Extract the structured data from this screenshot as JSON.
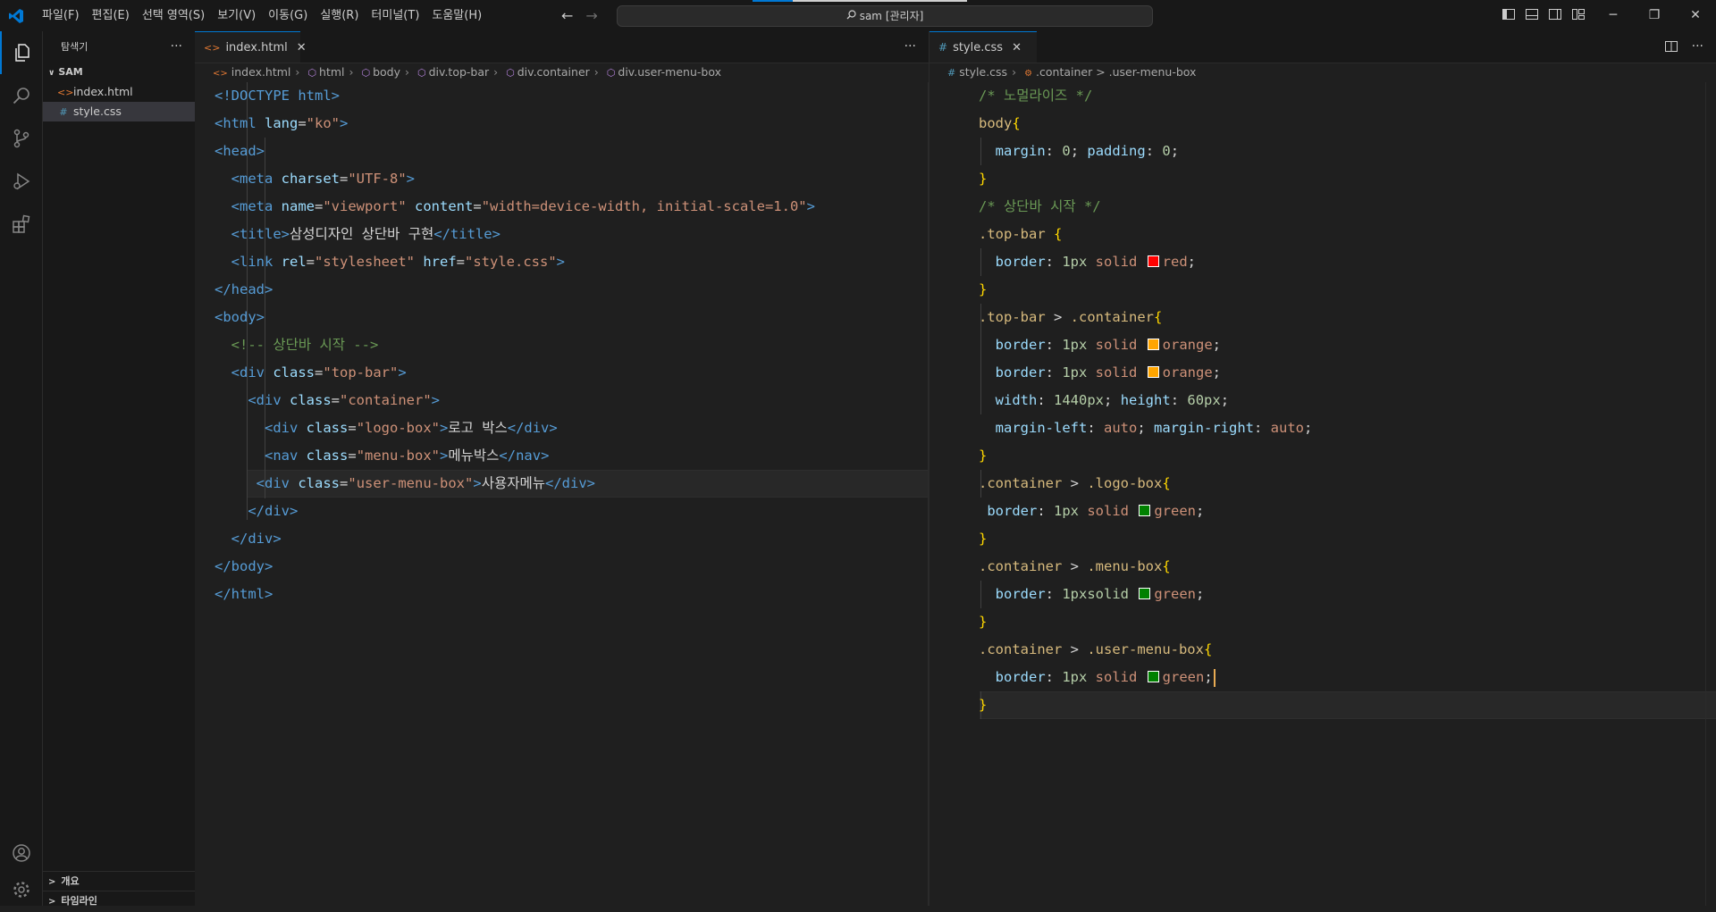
{
  "window": {
    "search_text": "sam [관리자]",
    "menus": [
      "파일(F)",
      "편집(E)",
      "선택 영역(S)",
      "보기(V)",
      "이동(G)",
      "실행(R)",
      "터미널(T)",
      "도움말(H)"
    ],
    "controls": {
      "minimize": "─",
      "maximize": "❐",
      "close": "✕"
    },
    "nav": {
      "back": "←",
      "forward": "→"
    }
  },
  "sidebar": {
    "title": "탐색기",
    "more": "···",
    "folder": "SAM",
    "files": [
      {
        "name": "index.html",
        "icon": "<>"
      },
      {
        "name": "style.css",
        "icon": "#"
      }
    ],
    "outline": "개요",
    "timeline": "타임라인"
  },
  "left_editor": {
    "tab": {
      "label": "index.html",
      "icon": "<>",
      "close": "✕"
    },
    "more": "···",
    "breadcrumb": [
      "index.html",
      "html",
      "body",
      "div.top-bar",
      "div.container",
      "div.user-menu-box"
    ],
    "lines": [
      [
        {
          "t": "<!DOCTYPE html>",
          "c": "tag"
        }
      ],
      [
        {
          "t": "<html ",
          "c": "tag"
        },
        {
          "t": "lang",
          "c": "attr"
        },
        {
          "t": "=",
          "c": "pun"
        },
        {
          "t": "\"ko\"",
          "c": "str"
        },
        {
          "t": ">",
          "c": "tag"
        }
      ],
      [
        {
          "t": "<head>",
          "c": "tag"
        }
      ],
      [
        {
          "t": "  "
        },
        {
          "t": "<meta ",
          "c": "tag"
        },
        {
          "t": "charset",
          "c": "attr"
        },
        {
          "t": "=",
          "c": "pun"
        },
        {
          "t": "\"UTF-8\"",
          "c": "str"
        },
        {
          "t": ">",
          "c": "tag"
        }
      ],
      [
        {
          "t": "  "
        },
        {
          "t": "<meta ",
          "c": "tag"
        },
        {
          "t": "name",
          "c": "attr"
        },
        {
          "t": "=",
          "c": "pun"
        },
        {
          "t": "\"viewport\"",
          "c": "str"
        },
        {
          "t": " ",
          "c": "pun"
        },
        {
          "t": "content",
          "c": "attr"
        },
        {
          "t": "=",
          "c": "pun"
        },
        {
          "t": "\"width=device-width, initial-scale=1.0\"",
          "c": "str"
        },
        {
          "t": ">",
          "c": "tag"
        }
      ],
      [
        {
          "t": "  "
        },
        {
          "t": "<title>",
          "c": "tag"
        },
        {
          "t": "삼성디자인 상단바 구현",
          "c": "txt"
        },
        {
          "t": "</title>",
          "c": "tag"
        }
      ],
      [
        {
          "t": "  "
        },
        {
          "t": "<link ",
          "c": "tag"
        },
        {
          "t": "rel",
          "c": "attr"
        },
        {
          "t": "=",
          "c": "pun"
        },
        {
          "t": "\"stylesheet\"",
          "c": "str"
        },
        {
          "t": " ",
          "c": "pun"
        },
        {
          "t": "href",
          "c": "attr"
        },
        {
          "t": "=",
          "c": "pun"
        },
        {
          "t": "\"style.css\"",
          "c": "str"
        },
        {
          "t": ">",
          "c": "tag"
        }
      ],
      [
        {
          "t": "</head>",
          "c": "tag"
        }
      ],
      [
        {
          "t": "<body>",
          "c": "tag"
        }
      ],
      [
        {
          "t": "  "
        },
        {
          "t": "<!-- 상단바 시작 -->",
          "c": "cm"
        }
      ],
      [
        {
          "t": "  "
        },
        {
          "t": "<div ",
          "c": "tag"
        },
        {
          "t": "class",
          "c": "attr"
        },
        {
          "t": "=",
          "c": "pun"
        },
        {
          "t": "\"top-bar\"",
          "c": "str"
        },
        {
          "t": ">",
          "c": "tag"
        }
      ],
      [
        {
          "t": "    "
        },
        {
          "t": "<div ",
          "c": "tag"
        },
        {
          "t": "class",
          "c": "attr"
        },
        {
          "t": "=",
          "c": "pun"
        },
        {
          "t": "\"container\"",
          "c": "str"
        },
        {
          "t": ">",
          "c": "tag"
        }
      ],
      [
        {
          "t": "      "
        },
        {
          "t": "<div ",
          "c": "tag"
        },
        {
          "t": "class",
          "c": "attr"
        },
        {
          "t": "=",
          "c": "pun"
        },
        {
          "t": "\"logo-box\"",
          "c": "str"
        },
        {
          "t": ">",
          "c": "tag"
        },
        {
          "t": "로고 박스",
          "c": "txt"
        },
        {
          "t": "</div>",
          "c": "tag"
        }
      ],
      [
        {
          "t": "      "
        },
        {
          "t": "<nav ",
          "c": "tag"
        },
        {
          "t": "class",
          "c": "attr"
        },
        {
          "t": "=",
          "c": "pun"
        },
        {
          "t": "\"menu-box\"",
          "c": "str"
        },
        {
          "t": ">",
          "c": "tag"
        },
        {
          "t": "메뉴박스",
          "c": "txt"
        },
        {
          "t": "</nav>",
          "c": "tag"
        }
      ],
      [
        {
          "t": "     "
        },
        {
          "t": "<div ",
          "c": "tag"
        },
        {
          "t": "class",
          "c": "attr"
        },
        {
          "t": "=",
          "c": "pun"
        },
        {
          "t": "\"user-menu-box\"",
          "c": "str"
        },
        {
          "t": ">",
          "c": "tag"
        },
        {
          "t": "사용자메뉴",
          "c": "txt"
        },
        {
          "t": "</div>",
          "c": "tag"
        }
      ],
      [
        {
          "t": "    "
        },
        {
          "t": "</div>",
          "c": "tag"
        }
      ],
      [
        {
          "t": "  "
        },
        {
          "t": "</div>",
          "c": "tag"
        }
      ],
      [
        {
          "t": "</body>",
          "c": "tag"
        }
      ],
      [
        {
          "t": "</html>",
          "c": "tag"
        }
      ]
    ]
  },
  "right_editor": {
    "tab": {
      "label": "style.css",
      "icon": "#",
      "close": "✕"
    },
    "breadcrumb": [
      "style.css",
      ".container > .user-menu-box"
    ],
    "lines": [
      [
        {
          "t": "/* 노멀라이즈 */",
          "c": "cm"
        }
      ],
      [
        {
          "t": "body",
          "c": "sel"
        },
        {
          "t": "{",
          "c": "brace"
        }
      ],
      [
        {
          "t": "  "
        },
        {
          "t": "margin",
          "c": "prop"
        },
        {
          "t": ": ",
          "c": "pun"
        },
        {
          "t": "0",
          "c": "num"
        },
        {
          "t": "; ",
          "c": "pun"
        },
        {
          "t": "padding",
          "c": "prop"
        },
        {
          "t": ": ",
          "c": "pun"
        },
        {
          "t": "0",
          "c": "num"
        },
        {
          "t": ";",
          "c": "pun"
        }
      ],
      [
        {
          "t": "}",
          "c": "brace"
        }
      ],
      [
        {
          "t": "/* 상단바 시작 */",
          "c": "cm"
        }
      ],
      [
        {
          "t": ".top-bar ",
          "c": "sel"
        },
        {
          "t": "{",
          "c": "brace"
        }
      ],
      [
        {
          "t": "  "
        },
        {
          "t": "border",
          "c": "prop"
        },
        {
          "t": ": ",
          "c": "pun"
        },
        {
          "t": "1px",
          "c": "num"
        },
        {
          "t": " solid ",
          "c": "kw"
        },
        {
          "sw": "#ff0000"
        },
        {
          "t": "red",
          "c": "kw"
        },
        {
          "t": ";",
          "c": "pun"
        }
      ],
      [
        {
          "t": "}",
          "c": "brace"
        }
      ],
      [
        {
          "t": ".top-bar ",
          "c": "sel"
        },
        {
          "t": "> ",
          "c": "pun"
        },
        {
          "t": ".container",
          "c": "sel"
        },
        {
          "t": "{",
          "c": "brace"
        }
      ],
      [
        {
          "t": "  "
        },
        {
          "t": "border",
          "c": "prop"
        },
        {
          "t": ": ",
          "c": "pun"
        },
        {
          "t": "1px",
          "c": "num"
        },
        {
          "t": " solid ",
          "c": "kw"
        },
        {
          "sw": "#ffa500"
        },
        {
          "t": "orange",
          "c": "kw"
        },
        {
          "t": ";",
          "c": "pun"
        }
      ],
      [
        {
          "t": "  "
        },
        {
          "t": "border",
          "c": "prop"
        },
        {
          "t": ": ",
          "c": "pun"
        },
        {
          "t": "1px",
          "c": "num"
        },
        {
          "t": " solid ",
          "c": "kw"
        },
        {
          "sw": "#ffa500"
        },
        {
          "t": "orange",
          "c": "kw"
        },
        {
          "t": ";",
          "c": "pun"
        }
      ],
      [
        {
          "t": "  "
        },
        {
          "t": "width",
          "c": "prop"
        },
        {
          "t": ": ",
          "c": "pun"
        },
        {
          "t": "1440px",
          "c": "num"
        },
        {
          "t": "; ",
          "c": "pun"
        },
        {
          "t": "height",
          "c": "prop"
        },
        {
          "t": ": ",
          "c": "pun"
        },
        {
          "t": "60px",
          "c": "num"
        },
        {
          "t": ";",
          "c": "pun"
        }
      ],
      [
        {
          "t": "  "
        },
        {
          "t": "margin-left",
          "c": "prop"
        },
        {
          "t": ": ",
          "c": "pun"
        },
        {
          "t": "auto",
          "c": "kw"
        },
        {
          "t": "; ",
          "c": "pun"
        },
        {
          "t": "margin-right",
          "c": "prop"
        },
        {
          "t": ": ",
          "c": "pun"
        },
        {
          "t": "auto",
          "c": "kw"
        },
        {
          "t": ";",
          "c": "pun"
        }
      ],
      [
        {
          "t": "}",
          "c": "brace"
        }
      ],
      [
        {
          "t": ".container ",
          "c": "sel"
        },
        {
          "t": "> ",
          "c": "pun"
        },
        {
          "t": ".logo-box",
          "c": "sel"
        },
        {
          "t": "{",
          "c": "brace"
        }
      ],
      [
        {
          "t": " "
        },
        {
          "t": "border",
          "c": "prop"
        },
        {
          "t": ": ",
          "c": "pun"
        },
        {
          "t": "1px",
          "c": "num"
        },
        {
          "t": " solid ",
          "c": "kw"
        },
        {
          "sw": "#008000"
        },
        {
          "t": "green",
          "c": "kw"
        },
        {
          "t": ";",
          "c": "pun"
        }
      ],
      [
        {
          "t": "}",
          "c": "brace"
        }
      ],
      [
        {
          "t": ".container ",
          "c": "sel"
        },
        {
          "t": "> ",
          "c": "pun"
        },
        {
          "t": ".menu-box",
          "c": "sel"
        },
        {
          "t": "{",
          "c": "brace"
        }
      ],
      [
        {
          "t": "  "
        },
        {
          "t": "border",
          "c": "prop"
        },
        {
          "t": ": ",
          "c": "pun"
        },
        {
          "t": "1pxsolid",
          "c": "num"
        },
        {
          "t": " ",
          "c": "pun"
        },
        {
          "sw": "#008000"
        },
        {
          "t": "green",
          "c": "kw"
        },
        {
          "t": ";",
          "c": "pun"
        }
      ],
      [
        {
          "t": "}",
          "c": "brace"
        }
      ],
      [
        {
          "t": ".container ",
          "c": "sel"
        },
        {
          "t": "> ",
          "c": "pun"
        },
        {
          "t": ".user-menu-box",
          "c": "sel"
        },
        {
          "t": "{",
          "c": "brace"
        }
      ],
      [
        {
          "t": "  "
        },
        {
          "t": "border",
          "c": "prop"
        },
        {
          "t": ": ",
          "c": "pun"
        },
        {
          "t": "1px",
          "c": "num"
        },
        {
          "t": " solid ",
          "c": "kw"
        },
        {
          "sw": "#008000"
        },
        {
          "t": "green",
          "c": "kw"
        },
        {
          "t": ";",
          "c": "pun"
        },
        {
          "cursor": true
        }
      ],
      [
        {
          "t": "}",
          "c": "brace"
        }
      ]
    ]
  }
}
